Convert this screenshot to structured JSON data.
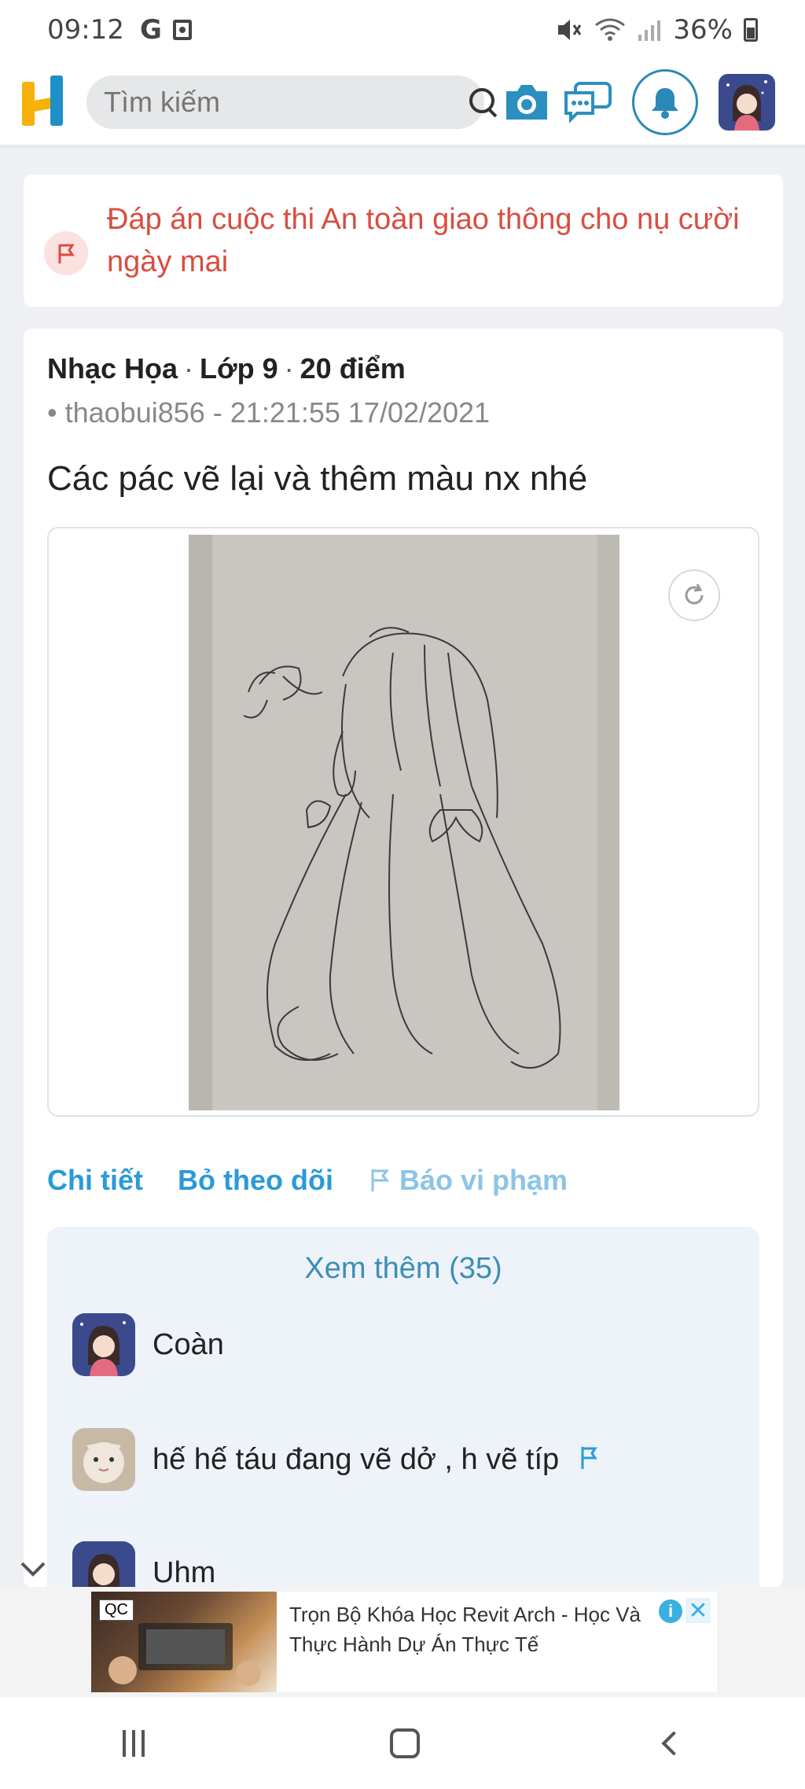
{
  "status_bar": {
    "time": "09:12",
    "g_icon": "G",
    "battery": "36%"
  },
  "header": {
    "search_placeholder": "Tìm kiếm",
    "colors": {
      "brand_blue": "#1f8fc9",
      "brand_yellow": "#f6b10a"
    }
  },
  "notice": {
    "text": "Đáp án cuộc thi An toàn giao thông cho nụ cười ngày mai",
    "color": "#d94d41"
  },
  "post": {
    "subject": "Nhạc Họa",
    "grade": "Lớp 9",
    "points": "20 điểm",
    "byline": "• thaobui856 - 21:21:55 17/02/2021",
    "question": "Các pác vẽ lại và thêm màu nx nhé",
    "actions": {
      "detail": "Chi tiết",
      "unfollow": "Bỏ theo dõi",
      "report": "Báo vi phạm"
    }
  },
  "comments": {
    "more": "Xem thêm (35)",
    "items": [
      {
        "text": "Coàn",
        "avatar": "anime-girl-avatar"
      },
      {
        "text": "hế hế táu đang vẽ dở , h vẽ típ",
        "avatar": "cat-avatar"
      },
      {
        "text": "Uhm",
        "avatar": "anime-girl-avatar"
      }
    ]
  },
  "ad": {
    "badge": "QC",
    "title": "Trọn Bộ Khóa Học Revit Arch - Học Và Thực Hành Dự Án Thực Tế"
  }
}
